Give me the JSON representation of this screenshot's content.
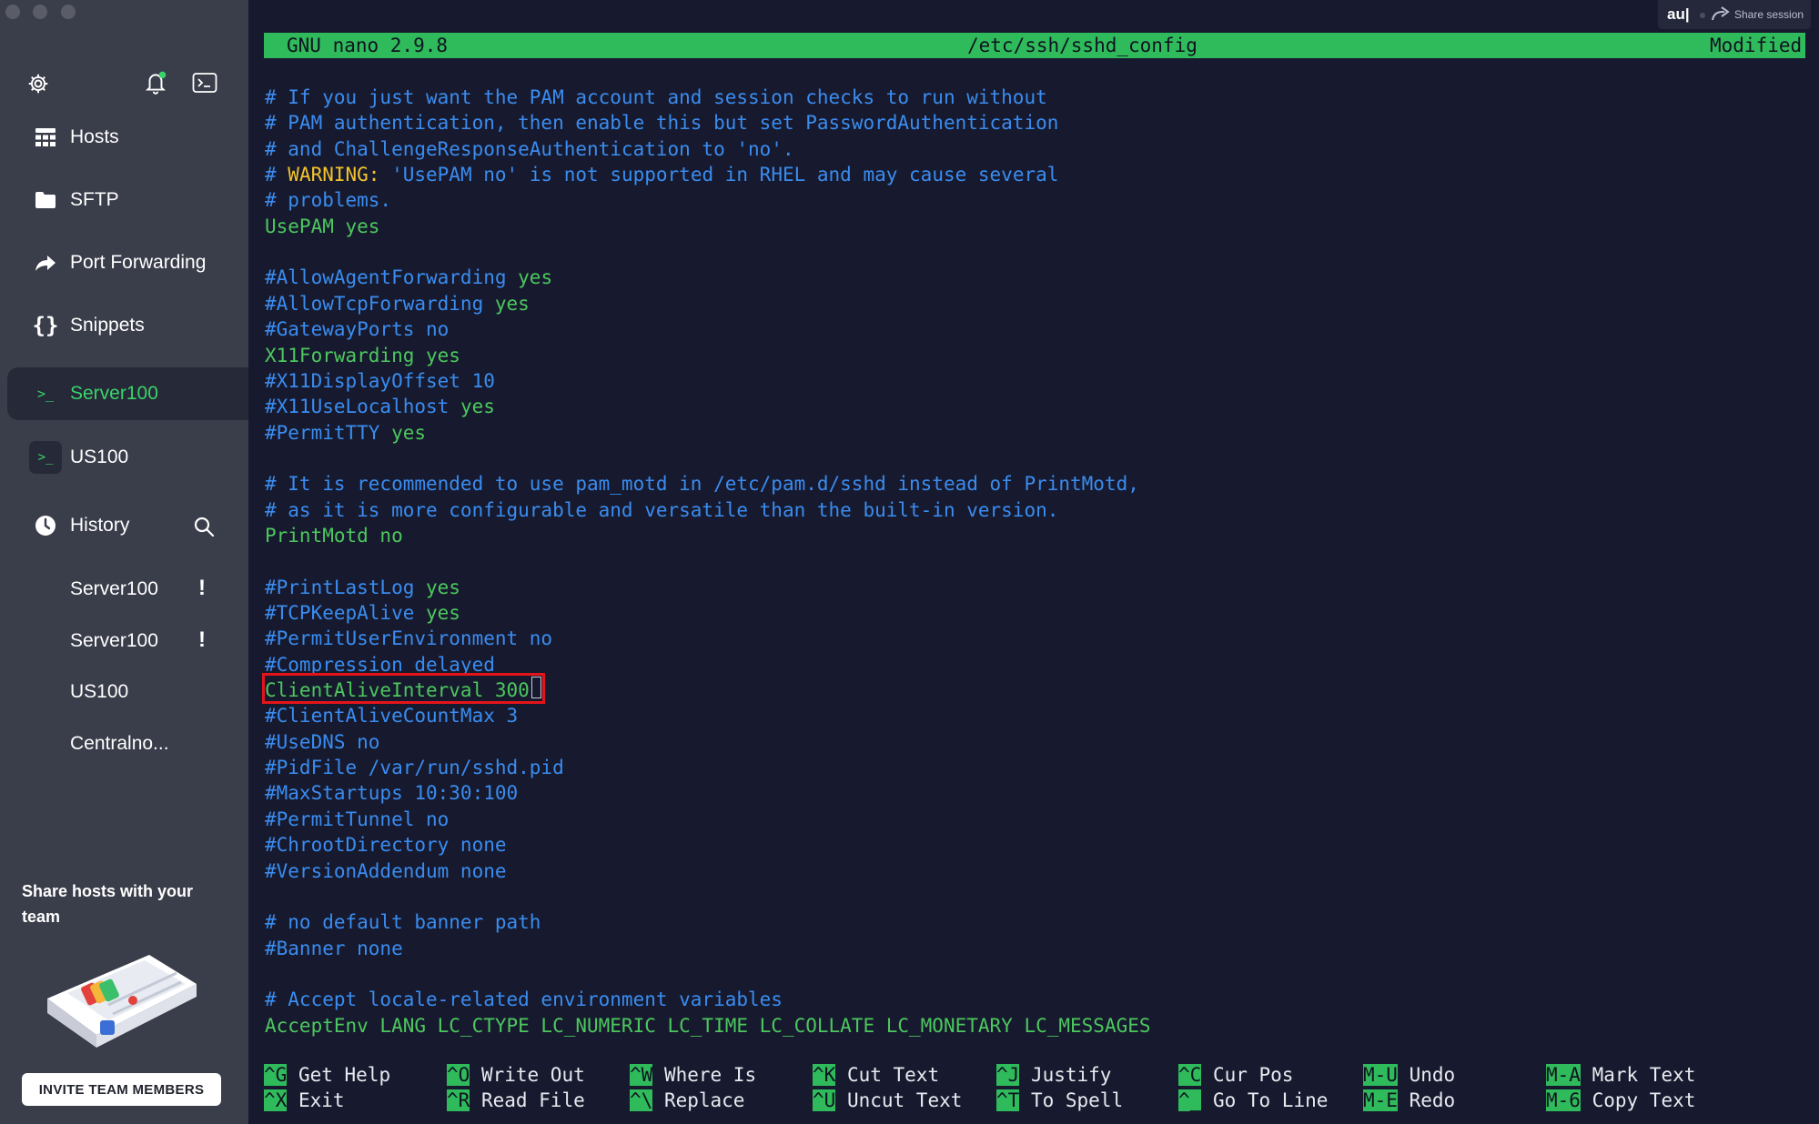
{
  "sidebar": {
    "icons": {
      "settings": "gear-icon",
      "notifications": "bell-icon",
      "terminal": "terminal-icon"
    },
    "nav": [
      {
        "label": "Hosts",
        "icon": "hosts-grid-icon"
      },
      {
        "label": "SFTP",
        "icon": "folder-icon"
      },
      {
        "label": "Port Forwarding",
        "icon": "port-forward-icon"
      },
      {
        "label": "Snippets",
        "icon": "braces-icon"
      },
      {
        "label": "Server100",
        "icon": "terminal-prompt-icon",
        "active": true
      },
      {
        "label": "US100",
        "icon": "terminal-prompt-icon"
      }
    ],
    "history": {
      "label": "History",
      "items": [
        {
          "label": "Server100",
          "warning": "!"
        },
        {
          "label": "Server100",
          "warning": "!"
        },
        {
          "label": "US100"
        },
        {
          "label": "Centralno..."
        }
      ]
    },
    "promo": {
      "title": "Share hosts with your team",
      "button": "INVITE TEAM MEMBERS"
    }
  },
  "terminal": {
    "share": {
      "user": "au|",
      "label": "Share session"
    },
    "nano": {
      "version": "GNU nano 2.9.8",
      "file": "/etc/ssh/sshd_config",
      "status": "Modified"
    },
    "lines": [
      [
        {
          "t": "# If you just want the PAM account and session checks to run without",
          "c": "blue"
        }
      ],
      [
        {
          "t": "# PAM authentication, then enable this but set PasswordAuthentication",
          "c": "blue"
        }
      ],
      [
        {
          "t": "# and ChallengeResponseAuthentication to 'no'.",
          "c": "blue"
        }
      ],
      [
        {
          "t": "# ",
          "c": "blue"
        },
        {
          "t": "WARNING:",
          "c": "yellow"
        },
        {
          "t": " 'UsePAM no' is not supported in RHEL and may cause several",
          "c": "blue"
        }
      ],
      [
        {
          "t": "# problems.",
          "c": "blue"
        }
      ],
      [
        {
          "t": "UsePAM yes",
          "c": "green"
        }
      ],
      [],
      [
        {
          "t": "#AllowAgentForwarding",
          "c": "blue"
        },
        {
          "t": " yes",
          "c": "green"
        }
      ],
      [
        {
          "t": "#AllowTcpForwarding",
          "c": "blue"
        },
        {
          "t": " yes",
          "c": "green"
        }
      ],
      [
        {
          "t": "#GatewayPorts no",
          "c": "blue"
        }
      ],
      [
        {
          "t": "X11Forwarding yes",
          "c": "green"
        }
      ],
      [
        {
          "t": "#X11DisplayOffset 10",
          "c": "blue"
        }
      ],
      [
        {
          "t": "#X11UseLocalhost",
          "c": "blue"
        },
        {
          "t": " yes",
          "c": "green"
        }
      ],
      [
        {
          "t": "#PermitTTY",
          "c": "blue"
        },
        {
          "t": " yes",
          "c": "green"
        }
      ],
      [],
      [
        {
          "t": "# It is recommended to use pam_motd in /etc/pam.d/sshd instead of PrintMotd,",
          "c": "blue"
        }
      ],
      [
        {
          "t": "# as it is more configurable and versatile than the built-in version.",
          "c": "blue"
        }
      ],
      [
        {
          "t": "PrintMotd no",
          "c": "green"
        }
      ],
      [],
      [
        {
          "t": "#PrintLastLog",
          "c": "blue"
        },
        {
          "t": " yes",
          "c": "green"
        }
      ],
      [
        {
          "t": "#TCPKeepAlive",
          "c": "blue"
        },
        {
          "t": " yes",
          "c": "green"
        }
      ],
      [
        {
          "t": "#PermitUserEnvironment no",
          "c": "blue"
        }
      ],
      [
        {
          "t": "#Compression delayed",
          "c": "blue"
        }
      ],
      [
        {
          "t": "ClientAliveInterval 300",
          "c": "green"
        }
      ],
      [
        {
          "t": "#ClientAliveCountMax 3",
          "c": "blue"
        }
      ],
      [
        {
          "t": "#UseDNS no",
          "c": "blue"
        }
      ],
      [
        {
          "t": "#PidFile /var/run/sshd.pid",
          "c": "blue"
        }
      ],
      [
        {
          "t": "#MaxStartups 10:30:100",
          "c": "blue"
        }
      ],
      [
        {
          "t": "#PermitTunnel no",
          "c": "blue"
        }
      ],
      [
        {
          "t": "#ChrootDirectory none",
          "c": "blue"
        }
      ],
      [
        {
          "t": "#VersionAddendum none",
          "c": "blue"
        }
      ],
      [],
      [
        {
          "t": "# no default banner path",
          "c": "blue"
        }
      ],
      [
        {
          "t": "#Banner none",
          "c": "blue"
        }
      ],
      [],
      [
        {
          "t": "# Accept locale-related environment variables",
          "c": "blue"
        }
      ],
      [
        {
          "t": "AcceptEnv LANG LC_CTYPE LC_NUMERIC LC_TIME LC_COLLATE LC_MONETARY LC_MESSAGES",
          "c": "green"
        }
      ]
    ],
    "shortcuts": [
      [
        {
          "k": "^G",
          "l": "Get Help"
        },
        {
          "k": "^O",
          "l": "Write Out"
        },
        {
          "k": "^W",
          "l": "Where Is"
        },
        {
          "k": "^K",
          "l": "Cut Text"
        },
        {
          "k": "^J",
          "l": "Justify"
        },
        {
          "k": "^C",
          "l": "Cur Pos"
        },
        {
          "k": "M-U",
          "l": "Undo"
        },
        {
          "k": "M-A",
          "l": "Mark Text"
        }
      ],
      [
        {
          "k": "^X",
          "l": "Exit"
        },
        {
          "k": "^R",
          "l": "Read File"
        },
        {
          "k": "^\\",
          "l": "Replace"
        },
        {
          "k": "^U",
          "l": "Uncut Text"
        },
        {
          "k": "^T",
          "l": "To Spell"
        },
        {
          "k": "^_",
          "l": "Go To Line"
        },
        {
          "k": "M-E",
          "l": "Redo"
        },
        {
          "k": "M-6",
          "l": "Copy Text"
        }
      ]
    ]
  }
}
